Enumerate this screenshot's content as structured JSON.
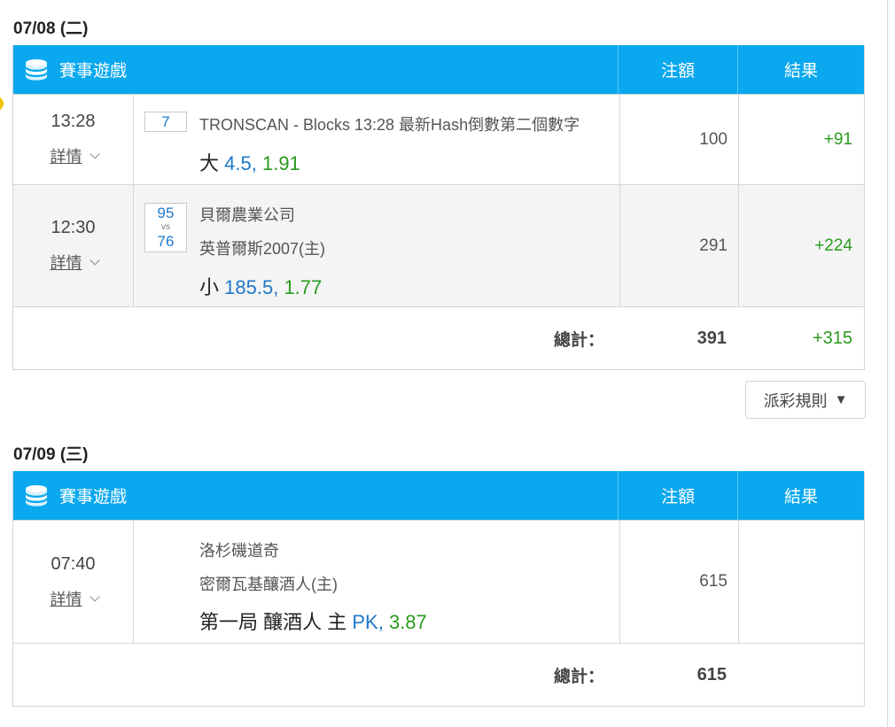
{
  "header": {
    "game": "賽事遊戲",
    "bet": "注額",
    "result": "結果"
  },
  "total_label": "總計：",
  "detail_label": "詳情",
  "rules_button": {
    "label": "派彩規則",
    "arrow": "▼"
  },
  "days": [
    {
      "date": "07/08 (二)",
      "rows": [
        {
          "time": "13:28",
          "box_top": "7",
          "line1": "TRONSCAN - Blocks 13:28 最新Hash倒數第二個數字",
          "pick_label": "大",
          "pick_line": "4.5,",
          "pick_odds": "1.91",
          "bet": "100",
          "result": "+91"
        },
        {
          "time": "12:30",
          "box_top": "95",
          "vs": "vs",
          "box_bottom": "76",
          "line1": "貝爾農業公司",
          "line2": "英普爾斯2007(主)",
          "pick_label": "小",
          "pick_line": "185.5,",
          "pick_odds": "1.77",
          "bet": "291",
          "result": "+224"
        }
      ],
      "total_bet": "391",
      "total_result": "+315"
    },
    {
      "date": "07/09 (三)",
      "rows": [
        {
          "time": "07:40",
          "line1": "洛杉磯道奇",
          "line2": "密爾瓦基釀酒人(主)",
          "pick_label": "第一局 釀酒人 主",
          "pick_line": "PK,",
          "pick_odds": "3.87",
          "bet": "615",
          "result": ""
        }
      ],
      "total_bet": "615",
      "total_result": ""
    }
  ],
  "colors": {
    "header_bg": "#0aa8ee",
    "win": "#2a9a1e",
    "line_blue": "#1f78c8"
  }
}
